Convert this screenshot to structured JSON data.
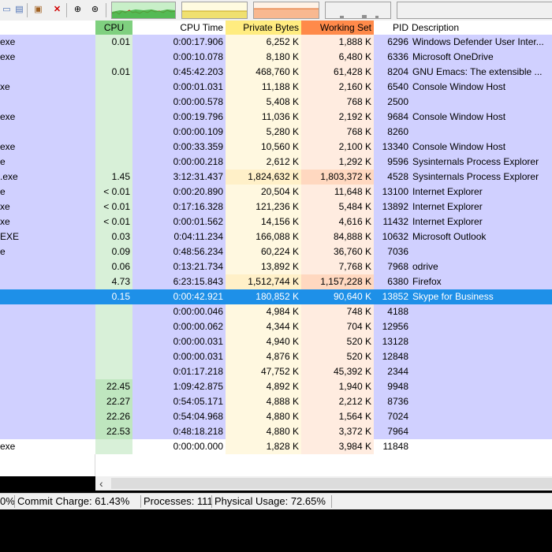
{
  "toolbar": {
    "icons": [
      "window-icon",
      "properties-icon",
      "kill-process-icon",
      "close-x-icon",
      "find-binoculars-icon",
      "target-crosshair-icon"
    ],
    "graphs": [
      "cpu-usage-graph",
      "commit-history-graph",
      "io-history-graph",
      "physical-memory-graph",
      "extra-graph"
    ]
  },
  "columns": {
    "cpu": "CPU",
    "cpu_time": "CPU Time",
    "private_bytes": "Private Bytes",
    "working_set": "Working Set",
    "pid": "PID",
    "description": "Description"
  },
  "colors": {
    "cpu_header": "#7fd07f",
    "private_header": "#ffec80",
    "working_header": "#ff8a4a",
    "row_purple": "#d0d0ff",
    "selected": "#1e90e8",
    "cpu_green": "#d8f0d8",
    "private_light": "#fff8e0",
    "working_light": "#ffece0"
  },
  "processes": [
    {
      "name": "exe",
      "cpu": "0.01",
      "cpu_time": "0:00:17.906",
      "private": "6,252 K",
      "working": "1,888 K",
      "pid": "6296",
      "desc": "Windows Defender User Inter...",
      "color": "purple",
      "hl": false,
      "sel": false
    },
    {
      "name": "exe",
      "cpu": "",
      "cpu_time": "0:00:10.078",
      "private": "8,180 K",
      "working": "6,480 K",
      "pid": "6336",
      "desc": "Microsoft OneDrive",
      "color": "purple",
      "hl": false,
      "sel": false
    },
    {
      "name": "",
      "cpu": "0.01",
      "cpu_time": "0:45:42.203",
      "private": "468,760 K",
      "working": "61,428 K",
      "pid": "8204",
      "desc": "GNU Emacs: The extensible ...",
      "color": "purple",
      "hl": false,
      "sel": false
    },
    {
      "name": "xe",
      "cpu": "",
      "cpu_time": "0:00:01.031",
      "private": "11,188 K",
      "working": "2,160 K",
      "pid": "6540",
      "desc": "Console Window Host",
      "color": "purple",
      "hl": false,
      "sel": false
    },
    {
      "name": "",
      "cpu": "",
      "cpu_time": "0:00:00.578",
      "private": "5,408 K",
      "working": "768 K",
      "pid": "2500",
      "desc": "",
      "color": "purple",
      "hl": false,
      "sel": false
    },
    {
      "name": "exe",
      "cpu": "",
      "cpu_time": "0:00:19.796",
      "private": "11,036 K",
      "working": "2,192 K",
      "pid": "9684",
      "desc": "Console Window Host",
      "color": "purple",
      "hl": false,
      "sel": false
    },
    {
      "name": "",
      "cpu": "",
      "cpu_time": "0:00:00.109",
      "private": "5,280 K",
      "working": "768 K",
      "pid": "8260",
      "desc": "",
      "color": "purple",
      "hl": false,
      "sel": false
    },
    {
      "name": "exe",
      "cpu": "",
      "cpu_time": "0:00:33.359",
      "private": "10,560 K",
      "working": "2,100 K",
      "pid": "13340",
      "desc": "Console Window Host",
      "color": "purple",
      "hl": false,
      "sel": false
    },
    {
      "name": "e",
      "cpu": "",
      "cpu_time": "0:00:00.218",
      "private": "2,612 K",
      "working": "1,292 K",
      "pid": "9596",
      "desc": "Sysinternals Process Explorer",
      "color": "purple",
      "hl": false,
      "sel": false
    },
    {
      "name": ".exe",
      "cpu": "1.45",
      "cpu_time": "3:12:31.437",
      "private": "1,824,632 K",
      "working": "1,803,372 K",
      "pid": "4528",
      "desc": "Sysinternals Process Explorer",
      "color": "purple",
      "hl": true,
      "sel": false
    },
    {
      "name": "e",
      "cpu": "< 0.01",
      "cpu_time": "0:00:20.890",
      "private": "20,504 K",
      "working": "11,648 K",
      "pid": "13100",
      "desc": "Internet Explorer",
      "color": "purple",
      "hl": false,
      "sel": false
    },
    {
      "name": "xe",
      "cpu": "< 0.01",
      "cpu_time": "0:17:16.328",
      "private": "121,236 K",
      "working": "5,484 K",
      "pid": "13892",
      "desc": "Internet Explorer",
      "color": "purple",
      "hl": false,
      "sel": false
    },
    {
      "name": "xe",
      "cpu": "< 0.01",
      "cpu_time": "0:00:01.562",
      "private": "14,156 K",
      "working": "4,616 K",
      "pid": "11432",
      "desc": "Internet Explorer",
      "color": "purple",
      "hl": false,
      "sel": false
    },
    {
      "name": "EXE",
      "cpu": "0.03",
      "cpu_time": "0:04:11.234",
      "private": "166,088 K",
      "working": "84,888 K",
      "pid": "10632",
      "desc": "Microsoft Outlook",
      "color": "purple",
      "hl": false,
      "sel": false
    },
    {
      "name": "e",
      "cpu": "0.09",
      "cpu_time": "0:48:56.234",
      "private": "60,224 K",
      "working": "36,760 K",
      "pid": "7036",
      "desc": "",
      "color": "purple",
      "hl": false,
      "sel": false
    },
    {
      "name": "",
      "cpu": "0.06",
      "cpu_time": "0:13:21.734",
      "private": "13,892 K",
      "working": "7,768 K",
      "pid": "7968",
      "desc": "odrive",
      "color": "purple",
      "hl": false,
      "sel": false
    },
    {
      "name": "",
      "cpu": "4.73",
      "cpu_time": "6:23:15.843",
      "private": "1,512,744 K",
      "working": "1,157,228 K",
      "pid": "6380",
      "desc": "Firefox",
      "color": "purple",
      "hl": true,
      "sel": false
    },
    {
      "name": "",
      "cpu": "0.15",
      "cpu_time": "0:00:42.921",
      "private": "180,852 K",
      "working": "90,640 K",
      "pid": "13852",
      "desc": "Skype for Business",
      "color": "selected",
      "hl": false,
      "sel": true
    },
    {
      "name": "",
      "cpu": "",
      "cpu_time": "0:00:00.046",
      "private": "4,984 K",
      "working": "748 K",
      "pid": "4188",
      "desc": "",
      "color": "purple",
      "hl": false,
      "sel": false
    },
    {
      "name": "",
      "cpu": "",
      "cpu_time": "0:00:00.062",
      "private": "4,344 K",
      "working": "704 K",
      "pid": "12956",
      "desc": "",
      "color": "purple",
      "hl": false,
      "sel": false
    },
    {
      "name": "",
      "cpu": "",
      "cpu_time": "0:00:00.031",
      "private": "4,940 K",
      "working": "520 K",
      "pid": "13128",
      "desc": "",
      "color": "purple",
      "hl": false,
      "sel": false
    },
    {
      "name": "",
      "cpu": "",
      "cpu_time": "0:00:00.031",
      "private": "4,876 K",
      "working": "520 K",
      "pid": "12848",
      "desc": "",
      "color": "purple",
      "hl": false,
      "sel": false
    },
    {
      "name": "",
      "cpu": "",
      "cpu_time": "0:01:17.218",
      "private": "47,752 K",
      "working": "45,392 K",
      "pid": "2344",
      "desc": "",
      "color": "purple",
      "hl": false,
      "sel": false
    },
    {
      "name": "",
      "cpu": "22.45",
      "cpu_time": "1:09:42.875",
      "private": "4,892 K",
      "working": "1,940 K",
      "pid": "9948",
      "desc": "",
      "color": "purple",
      "hl": false,
      "sel": false
    },
    {
      "name": "",
      "cpu": "22.27",
      "cpu_time": "0:54:05.171",
      "private": "4,888 K",
      "working": "2,212 K",
      "pid": "8736",
      "desc": "",
      "color": "purple",
      "hl": false,
      "sel": false
    },
    {
      "name": "",
      "cpu": "22.26",
      "cpu_time": "0:54:04.968",
      "private": "4,880 K",
      "working": "1,564 K",
      "pid": "7024",
      "desc": "",
      "color": "purple",
      "hl": false,
      "sel": false
    },
    {
      "name": "",
      "cpu": "22.53",
      "cpu_time": "0:48:18.218",
      "private": "4,880 K",
      "working": "3,372 K",
      "pid": "7964",
      "desc": "",
      "color": "purple",
      "hl": false,
      "sel": false
    },
    {
      "name": "exe",
      "cpu": "",
      "cpu_time": "0:00:00.000",
      "private": "1,828 K",
      "working": "3,984 K",
      "pid": "11848",
      "desc": "",
      "color": "white",
      "hl": false,
      "sel": false
    }
  ],
  "scrollbar": {
    "left_arrow": "‹"
  },
  "status": {
    "cpu_fragment": "0%",
    "commit": "Commit Charge: 61.43%",
    "processes": "Processes: 111",
    "physical": "Physical Usage: 72.65%"
  }
}
